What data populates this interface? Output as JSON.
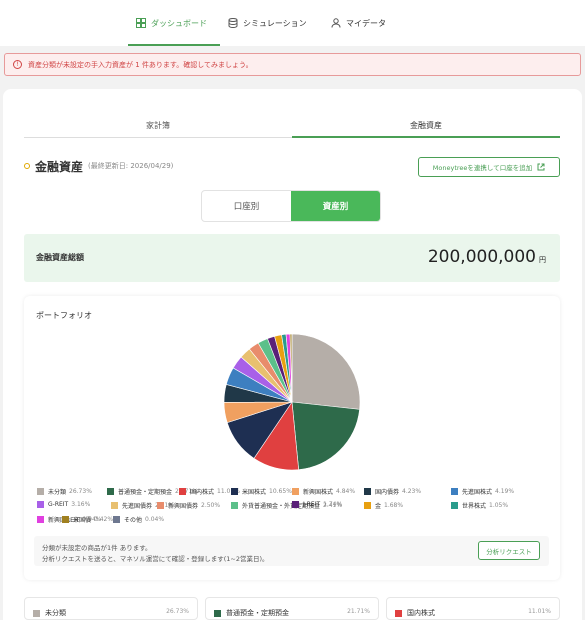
{
  "nav": {
    "tabs": [
      {
        "label": "ダッシュボード",
        "icon": "dashboard-icon",
        "active": true
      },
      {
        "label": "シミュレーション",
        "icon": "database-icon",
        "active": false
      },
      {
        "label": "マイデータ",
        "icon": "user-icon",
        "active": false
      }
    ]
  },
  "alert": {
    "icon": "info-circle-icon",
    "text": "資産分類が未設定の手入力資産が 1 件あります。確認してみましょう。"
  },
  "subtabs": [
    "家計簿",
    "金融資産"
  ],
  "heading": {
    "title": "金融資産",
    "updated": "(最終更新日: 2026/04/29)"
  },
  "link_button": {
    "label": "Moneytreeを連携して口座を追加",
    "icon": "external-link-icon"
  },
  "segment": {
    "options": [
      "口座別",
      "資産別"
    ],
    "selected": "資産別"
  },
  "total": {
    "label": "金融資産総額",
    "value": "200,000,000",
    "unit": "円"
  },
  "portfolio": {
    "title": "ポートフォリオ",
    "note_line1": "分類が未設定の商品が1件 あります。",
    "note_line2": "分析リクエストを送ると、マネソル運営にて確認・登録します(1~2営業日)。",
    "request_button": "分析リクエスト"
  },
  "chart_data": {
    "type": "pie",
    "slices": [
      {
        "label": "未分類",
        "pct_label": "26.73%",
        "value": 26.73,
        "color": "#b5aea8"
      },
      {
        "label": "普通預金・定期預金",
        "pct_label": "21.71%",
        "value": 21.71,
        "color": "#2e6a4a"
      },
      {
        "label": "国内株式",
        "pct_label": "11.01%",
        "value": 11.01,
        "color": "#e04040"
      },
      {
        "label": "米国株式",
        "pct_label": "10.65%",
        "value": 10.65,
        "color": "#1e2f52"
      },
      {
        "label": "新興国株式",
        "pct_label": "4.84%",
        "value": 4.84,
        "color": "#f0a060"
      },
      {
        "label": "国内債券",
        "pct_label": "4.23%",
        "value": 4.23,
        "color": "#203848"
      },
      {
        "label": "先進国株式",
        "pct_label": "4.19%",
        "value": 4.19,
        "color": "#3d7fc0"
      },
      {
        "label": "G-REIT",
        "pct_label": "3.16%",
        "value": 3.16,
        "color": "#a860e8"
      },
      {
        "label": "先進国債券",
        "pct_label": "2.71%",
        "value": 2.71,
        "color": "#e8c070"
      },
      {
        "label": "新興国債券",
        "pct_label": "2.50%",
        "value": 2.5,
        "color": "#e88c6c"
      },
      {
        "label": "外貨普通預金・外貨定期預金",
        "pct_label": "2.41%",
        "value": 2.41,
        "color": "#5cc08a"
      },
      {
        "label": "J-REIT",
        "pct_label": "1.74%",
        "value": 1.74,
        "color": "#5a2078"
      },
      {
        "label": "金",
        "pct_label": "1.68%",
        "value": 1.68,
        "color": "#e8a010"
      },
      {
        "label": "世界株式",
        "pct_label": "1.05%",
        "value": 1.05,
        "color": "#2a9c8c"
      },
      {
        "label": "新興国REIT",
        "pct_label": "0.94%",
        "value": 0.94,
        "color": "#e040e0"
      },
      {
        "label": "米国債",
        "pct_label": "0.42%",
        "value": 0.42,
        "color": "#a08020"
      },
      {
        "label": "その他",
        "pct_label": "0.04%",
        "value": 0.04,
        "color": "#6e7890"
      }
    ]
  },
  "bottom_cards": [
    {
      "label": "未分類",
      "pct": "26.73%",
      "color": "#b5aea8"
    },
    {
      "label": "普通預金・定期預金",
      "pct": "21.71%",
      "color": "#2e6a4a"
    },
    {
      "label": "国内株式",
      "pct": "11.01%",
      "color": "#e04040"
    }
  ]
}
